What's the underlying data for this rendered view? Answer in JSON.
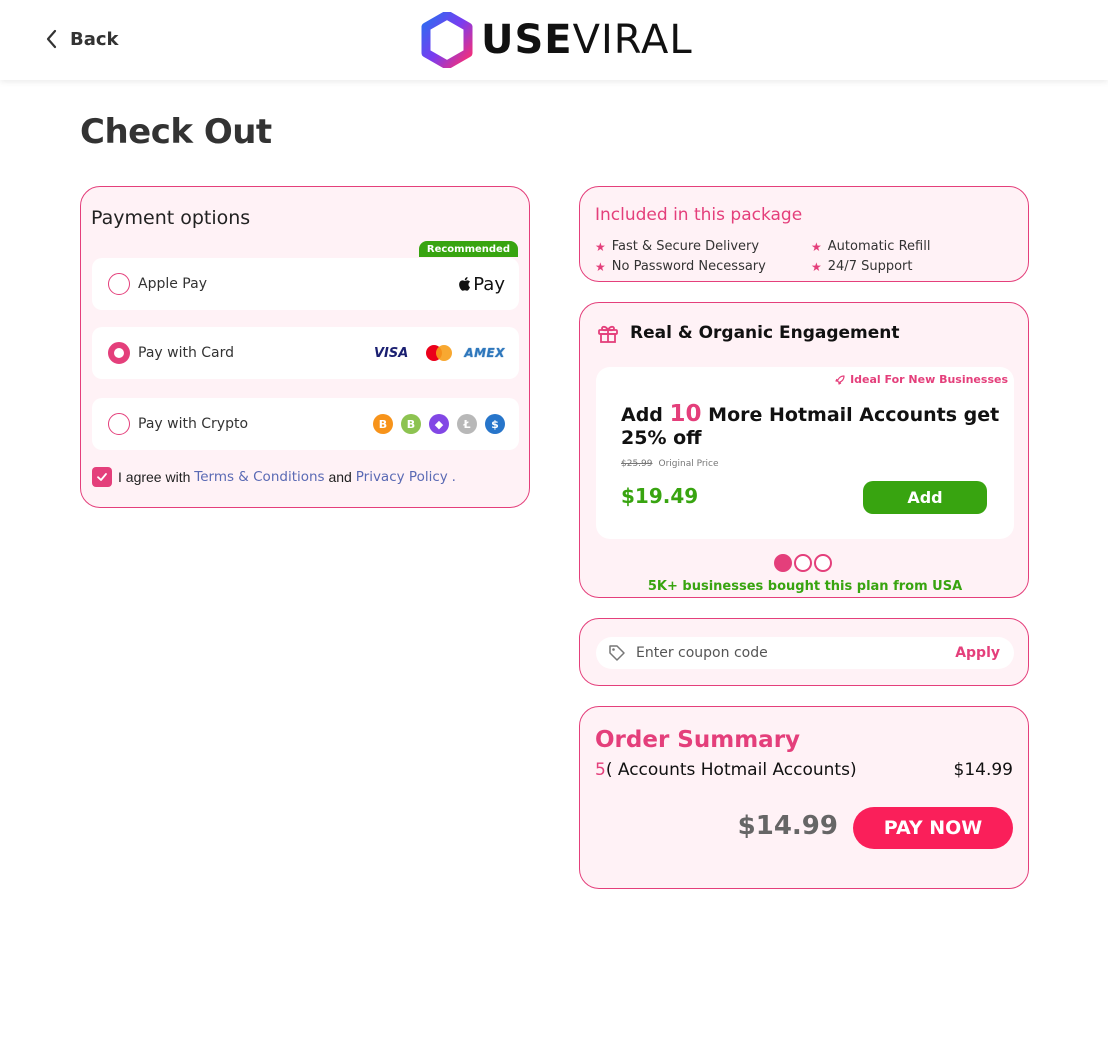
{
  "header": {
    "back_label": "Back",
    "logo_bold": "USE",
    "logo_light": "VIRAL"
  },
  "page_title": "Check Out",
  "payment": {
    "title": "Payment options",
    "recommended_badge": "Recommended",
    "options": [
      {
        "label": "Apple Pay",
        "selected": false,
        "logo_text": "Pay"
      },
      {
        "label": "Pay with Card",
        "selected": true,
        "logos": [
          "VISA",
          "mastercard",
          "AMEX"
        ]
      },
      {
        "label": "Pay with Crypto",
        "selected": false,
        "coins": [
          {
            "name": "bitcoin-icon",
            "symbol": "B",
            "color": "#f7931a"
          },
          {
            "name": "bitcoin-cash-icon",
            "symbol": "B",
            "color": "#8dc351"
          },
          {
            "name": "ethereum-icon",
            "symbol": "◆",
            "color": "#8247e5"
          },
          {
            "name": "litecoin-icon",
            "symbol": "Ł",
            "color": "#b8b8b8"
          },
          {
            "name": "usdc-icon",
            "symbol": "$",
            "color": "#2775ca"
          }
        ]
      }
    ],
    "agree": {
      "checked": true,
      "prefix": "I agree with",
      "terms": "Terms & Conditions",
      "and": "and",
      "privacy": "Privacy Policy",
      "suffix": "."
    }
  },
  "included": {
    "title": "Included in this package",
    "items": [
      "Fast & Secure Delivery",
      "Automatic Refill",
      "No Password Necessary",
      "24/7 Support"
    ]
  },
  "engagement": {
    "title": "Real & Organic Engagement",
    "ideal_label": "Ideal For New Businesses",
    "offer_prefix": "Add",
    "offer_qty": "10",
    "offer_rest": "More Hotmail Accounts get 25% off",
    "old_price": "$25.99",
    "old_price_label": "Original Price",
    "new_price": "$19.49",
    "add_label": "Add",
    "active_dot": 0,
    "bought_text": "5K+ businesses bought this plan from USA"
  },
  "coupon": {
    "placeholder": "Enter coupon code",
    "apply_label": "Apply"
  },
  "summary": {
    "title": "Order Summary",
    "qty": "5",
    "item_label": "( Accounts Hotmail Accounts)",
    "item_price": "$14.99",
    "total": "$14.99",
    "pay_label": "PAY NOW"
  },
  "colors": {
    "brand_pink": "#e43f7b",
    "pay_button": "#fa1f5a",
    "success_green": "#38a410",
    "card_bg": "#fff2f6"
  }
}
